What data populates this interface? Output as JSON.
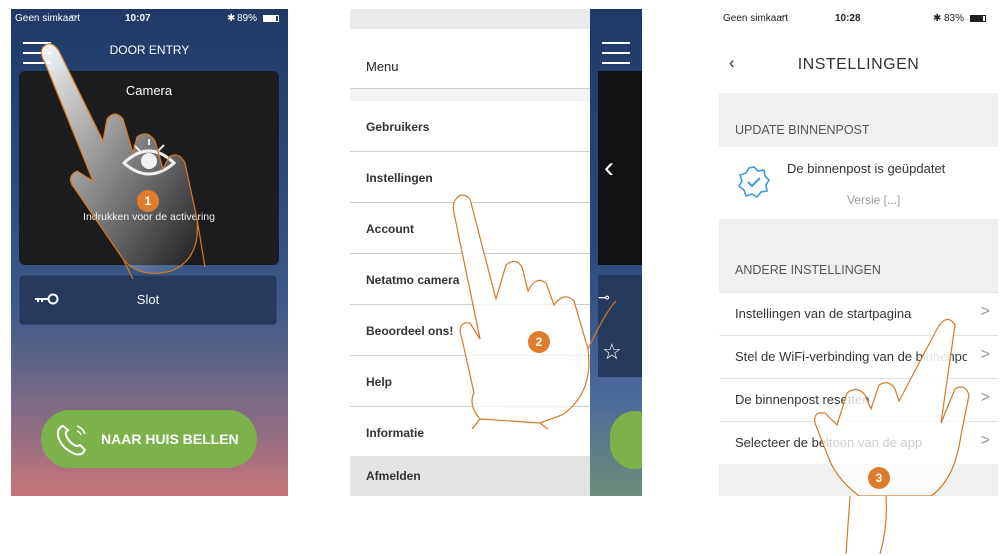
{
  "phone1": {
    "carrier": "Geen simkaart",
    "time": "10:07",
    "battery": "89%",
    "title": "DOOR ENTRY",
    "camera_label": "Camera",
    "activation_text": "Indrukken voor de activering",
    "lock_label": "Slot",
    "call_button": "NAAR HUIS BELLEN",
    "step": "1"
  },
  "phone2": {
    "menu_title": "Menu",
    "items": [
      {
        "label": "Gebruikers"
      },
      {
        "label": "Instellingen"
      },
      {
        "label": "Account"
      },
      {
        "label": "Netatmo camera"
      },
      {
        "label": "Beoordeel ons!"
      },
      {
        "label": "Help"
      },
      {
        "label": "Informatie"
      }
    ],
    "logout": "Afmelden",
    "step": "2"
  },
  "phone3": {
    "carrier": "Geen simkaart",
    "time": "10:28",
    "battery": "83%",
    "title": "INSTELLINGEN",
    "section1": "UPDATE BINNENPOST",
    "update_text": "De binnenpost is geüpdatet",
    "version_text": "Versie [...]",
    "section2": "ANDERE INSTELLINGEN",
    "rows": [
      {
        "label": "Instellingen van de startpagina"
      },
      {
        "label": "Stel de WiFi-verbinding van de binnenpost in"
      },
      {
        "label": "De binnenpost resetten"
      },
      {
        "label": "Selecteer de beltoon van de app"
      }
    ],
    "step": "3"
  },
  "colors": {
    "accent_orange": "#e07b2b",
    "call_green": "#7bb24a",
    "phone_blue": "#2b4a7c"
  }
}
